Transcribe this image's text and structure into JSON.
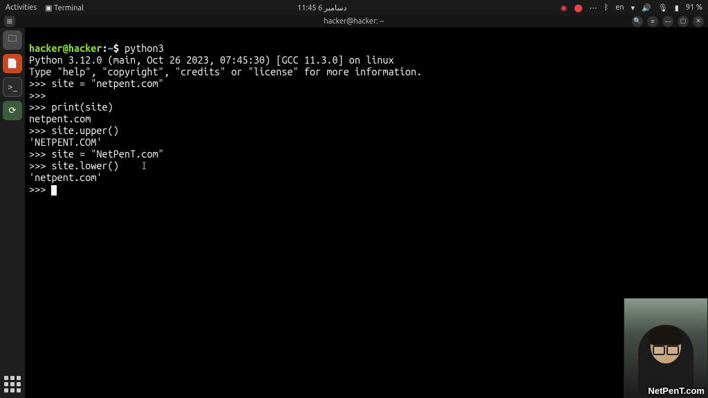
{
  "top_panel": {
    "activities": "Activities",
    "app_indicator": "Terminal",
    "clock": "11:45 دسامبر 6",
    "lang": "en",
    "battery": "91 %"
  },
  "titlebar": {
    "title": "hacker@hacker: ~"
  },
  "terminal": {
    "prompt_user": "hacker@hacker",
    "prompt_path": "~",
    "command": "python3",
    "lines": {
      "l1": "Python 3.12.0 (main, Oct 26 2023, 07:45:30) [GCC 11.3.0] on linux",
      "l2": "Type \"help\", \"copyright\", \"credits\" or \"license\" for more information.",
      "l3": ">>> site = \"netpent.com\"",
      "l4": ">>> ",
      "l5": ">>> print(site)",
      "l6": "netpent.com",
      "l7": ">>> site.upper()",
      "l8": "'NETPENT.COM'",
      "l9": ">>> site = \"NetPenT.com\"",
      "l10": ">>> site.lower()",
      "l11": "'netpent.com'",
      "l12": ">>> "
    }
  },
  "watermark": "NetPenT.com"
}
